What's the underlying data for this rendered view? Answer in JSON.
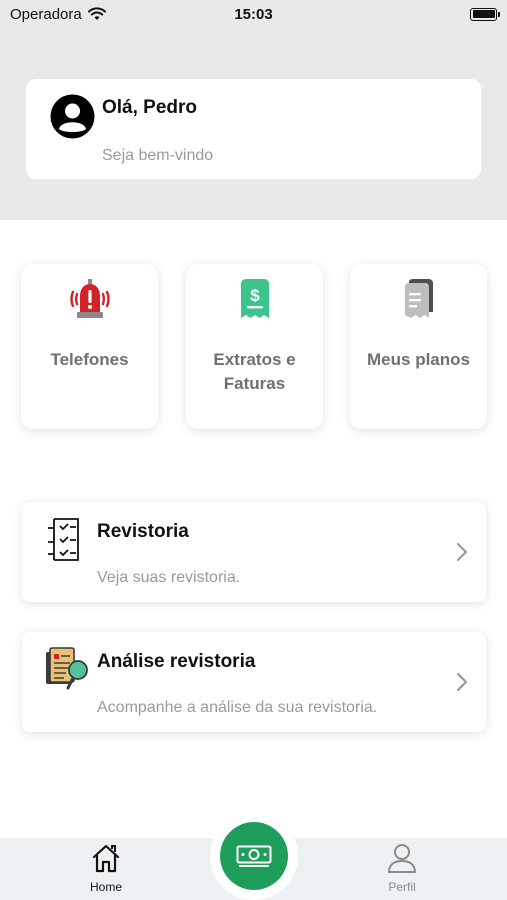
{
  "status_bar": {
    "carrier": "Operadora",
    "time": "15:03",
    "icons": [
      "wifi-icon",
      "battery-icon"
    ]
  },
  "greeting": {
    "title": "Olá, Pedro",
    "subtitle": "Seja bem-vindo",
    "avatar_icon": "user-circle-icon"
  },
  "quick_actions": [
    {
      "label": "Telefones",
      "icon": "alarm-bell-icon",
      "color": "#d2232a"
    },
    {
      "label": "Extratos e Faturas",
      "icon": "receipt-dollar-icon",
      "color": "#3cc48a"
    },
    {
      "label": "Meus planos",
      "icon": "documents-icon",
      "color": "#9e9e9e"
    }
  ],
  "list_items": [
    {
      "title": "Revistoria",
      "subtitle": "Veja suas revistoria.",
      "icon": "checklist-icon"
    },
    {
      "title": "Análise revistoria",
      "subtitle": "Acompanhe a análise da sua revistoria.",
      "icon": "document-search-icon"
    }
  ],
  "tab_bar": {
    "home_label": "Home",
    "profile_label": "Perfil",
    "center_icon": "money-icon",
    "active_tab": "Home",
    "accent_color": "#1e9e5a"
  }
}
